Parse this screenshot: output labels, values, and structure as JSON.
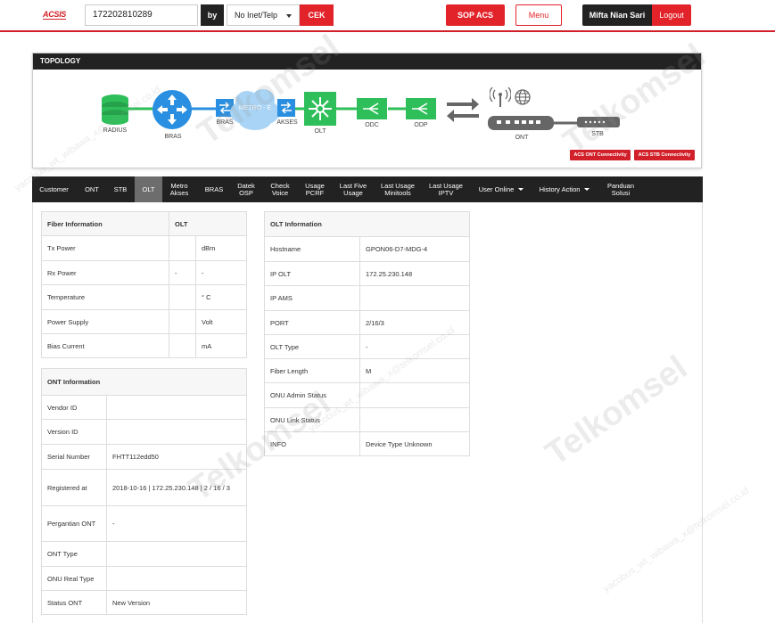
{
  "header": {
    "logo": "ACSIS",
    "search_value": "172202810289",
    "by_label": "by",
    "type_select": "No Inet/Telp",
    "cek_label": "CEK",
    "sop_label": "SOP ACS",
    "menu_label": "Menu",
    "user_name": "Mifta Nian Sari",
    "logout_label": "Logout"
  },
  "topology": {
    "title": "TOPOLOGY",
    "nodes": {
      "radius": "RADIUS",
      "bras": "BRAS",
      "bras2": "BRAS",
      "metro": "METRO - E",
      "akses": "AKSES",
      "olt": "OLT",
      "odc": "ODC",
      "odp": "ODP",
      "ont": "ONT",
      "stb": "STB"
    },
    "acs_ont": "ACS ONT Connectivity",
    "acs_stb": "ACS STB Connectivity"
  },
  "tabs": [
    {
      "label": "Customer"
    },
    {
      "label": "ONT"
    },
    {
      "label": "STB"
    },
    {
      "label": "OLT"
    },
    {
      "label": "Metro Akses"
    },
    {
      "label": "BRAS"
    },
    {
      "label": "Datek OSP"
    },
    {
      "label": "Check Voice"
    },
    {
      "label": "Usage PCRF"
    },
    {
      "label": "Last Five Usage"
    },
    {
      "label": "Last Usage Minitools"
    },
    {
      "label": "Last Usage IPTV"
    },
    {
      "label": "User Online"
    },
    {
      "label": "History Action"
    },
    {
      "label": "Panduan Solusi"
    }
  ],
  "fiber": {
    "header": "Fiber Information",
    "header_col": "OLT",
    "rows": [
      {
        "label": "Tx Power",
        "value": "",
        "unit": "dBm"
      },
      {
        "label": "Rx Power",
        "value": "-",
        "unit": "-"
      },
      {
        "label": "Temperature",
        "value": "",
        "unit": "° C"
      },
      {
        "label": "Power Supply",
        "value": "",
        "unit": "Volt"
      },
      {
        "label": "Bias Current",
        "value": "",
        "unit": "mA"
      }
    ]
  },
  "ont": {
    "header": "ONT Information",
    "rows": [
      {
        "label": "Vendor ID",
        "value": ""
      },
      {
        "label": "Version ID",
        "value": ""
      },
      {
        "label": "Serial Number",
        "value": "FHTT112edd50"
      },
      {
        "label": "Registered at",
        "value": "2018-10-16 | 172.25.230.148 | 2 / 16 / 3"
      },
      {
        "label": "Pergantian ONT",
        "value": "-"
      },
      {
        "label": "ONT Type",
        "value": ""
      },
      {
        "label": "ONU Real Type",
        "value": ""
      },
      {
        "label": "Status ONT",
        "value": "New Version"
      }
    ]
  },
  "olt": {
    "header": "OLT Information",
    "rows": [
      {
        "label": "Hostname",
        "value": "GPON06-D7-MDG-4"
      },
      {
        "label": "IP OLT",
        "value": "172.25.230.148"
      },
      {
        "label": "IP AMS",
        "value": ""
      },
      {
        "label": "PORT",
        "value": "2/16/3"
      },
      {
        "label": "OLT Type",
        "value": "-"
      },
      {
        "label": "Fiber Length",
        "value": "M"
      },
      {
        "label": "ONU Admin Status",
        "value": ""
      },
      {
        "label": "ONU Link Status",
        "value": ""
      },
      {
        "label": "INFO",
        "value": "Device Type Unknown"
      }
    ]
  },
  "watermark": {
    "brand": "Telkomsel",
    "user": "yacobus_wt_wibawa_x@telkomsel.co.id"
  },
  "colors": {
    "brand_red": "#e2232a",
    "dark": "#222222",
    "node_blue": "#2a8fe0",
    "node_green": "#2fbf5a"
  }
}
